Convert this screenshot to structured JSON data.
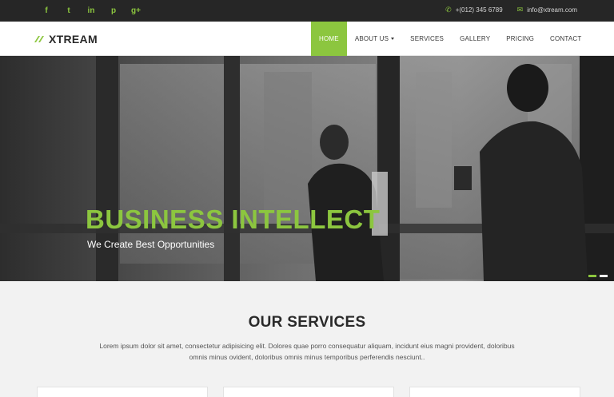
{
  "topbar": {
    "social": [
      "f",
      "t",
      "in",
      "p",
      "g+"
    ],
    "phone": "+(012) 345 6789",
    "email": "info@xtream.com",
    "colors": {
      "background": "#262626",
      "accent": "#8cc63f"
    }
  },
  "nav": {
    "logo": "XTREAM",
    "items": [
      {
        "label": "HOME",
        "active": true
      },
      {
        "label": "ABOUT US",
        "dropdown": true
      },
      {
        "label": "SERVICES"
      },
      {
        "label": "GALLERY"
      },
      {
        "label": "PRICING"
      },
      {
        "label": "CONTACT"
      }
    ]
  },
  "hero": {
    "title": "BUSINESS INTELLECT",
    "subtitle": "We Create Best Opportunities",
    "slides_active": 1
  },
  "services": {
    "title": "OUR SERVICES",
    "text": "Lorem ipsum dolor sit amet, consectetur adipisicing elit. Dolores quae porro consequatur aliquam, incidunt eius magni provident, doloribus omnis minus ovident, doloribus omnis minus temporibus perferendis nesciunt.."
  }
}
